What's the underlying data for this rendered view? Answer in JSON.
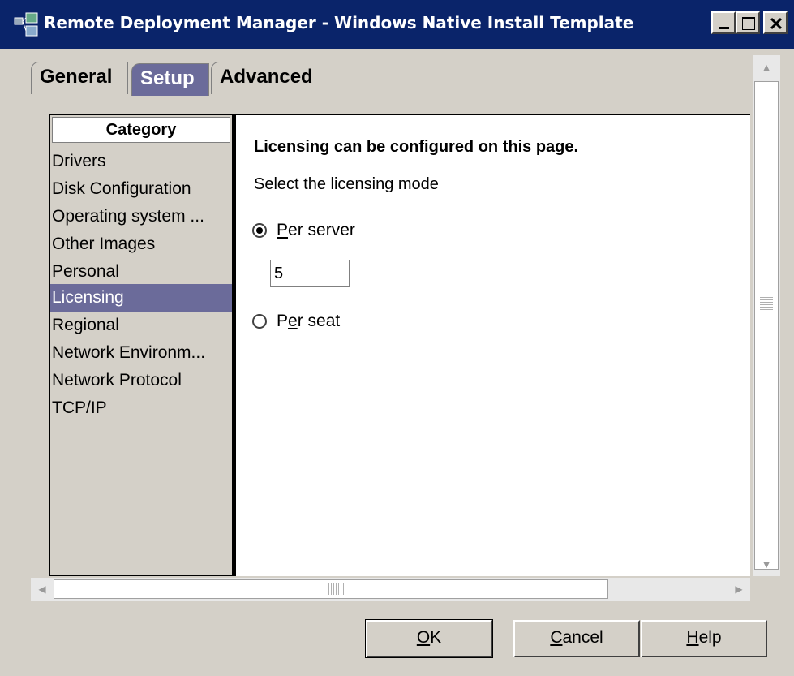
{
  "window": {
    "title": "Remote Deployment Manager - Windows Native Install Template"
  },
  "tabs": [
    {
      "label": "General"
    },
    {
      "label": "Setup"
    },
    {
      "label": "Advanced"
    }
  ],
  "category": {
    "header": "Category",
    "items": [
      {
        "label": "Drivers"
      },
      {
        "label": "Disk Configuration"
      },
      {
        "label": "Operating system ..."
      },
      {
        "label": "Other Images"
      },
      {
        "label": "Personal"
      },
      {
        "label": "Licensing"
      },
      {
        "label": "Regional"
      },
      {
        "label": "Network Environm..."
      },
      {
        "label": "Network Protocol"
      },
      {
        "label": "TCP/IP"
      }
    ],
    "selected": "Licensing"
  },
  "content": {
    "heading": "Licensing can be configured on this page.",
    "subheading": "Select the licensing mode",
    "per_server": {
      "mnemonic": "P",
      "rest": "er server",
      "checked": true
    },
    "per_server_value": "5",
    "per_seat": {
      "prefix": "P",
      "mnemonic": "e",
      "rest": "r seat",
      "checked": false
    }
  },
  "buttons": {
    "ok": {
      "mnemonic": "O",
      "rest": "K"
    },
    "cancel": {
      "mnemonic": "C",
      "rest": "ancel"
    },
    "help": {
      "mnemonic": "H",
      "rest": "elp"
    }
  },
  "colors": {
    "titlebar": "#0a246a",
    "selection": "#6b6b9a",
    "face": "#d4d0c8"
  }
}
